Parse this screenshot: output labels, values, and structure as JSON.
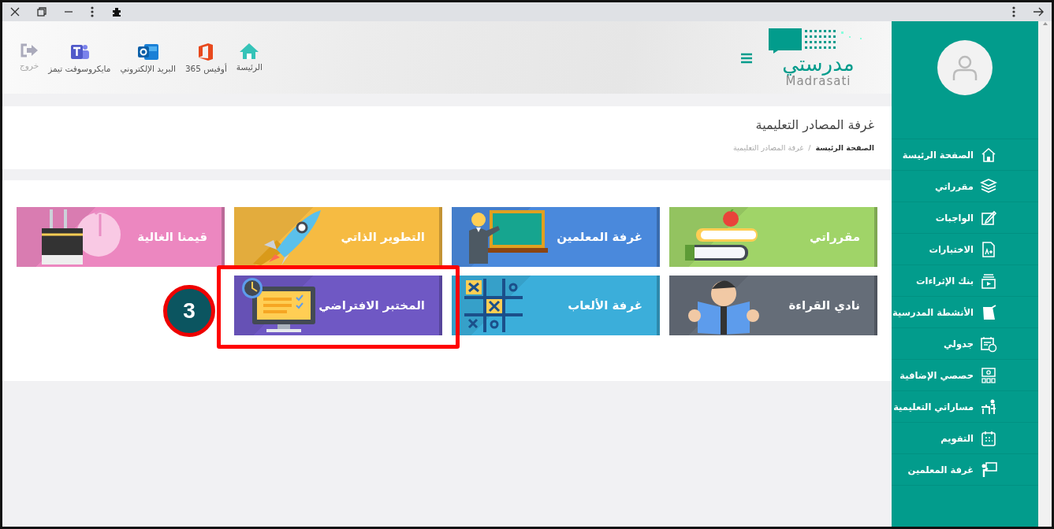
{
  "header_nav": [
    {
      "kind": "home",
      "label": "الرئيسة",
      "disabled": false
    },
    {
      "kind": "office",
      "label": "أوفيس 365",
      "disabled": false
    },
    {
      "kind": "outlook",
      "label": "البريد الإلكتروني",
      "disabled": false
    },
    {
      "kind": "teams",
      "label": "مايكروسوفت تيمز",
      "disabled": false
    },
    {
      "kind": "logout",
      "label": "خروج",
      "disabled": true
    }
  ],
  "logo": {
    "arabic": "مدرستي",
    "latin": "Madrasati"
  },
  "page_title": "غرفة المصادر التعليمية",
  "breadcrumb": {
    "home": "الصفحة الرئيسة",
    "separator": "/",
    "current": "غرفة المصادر التعليمية"
  },
  "tiles": [
    {
      "kind": "books",
      "label": "مقرراتي",
      "color": "#a0d468",
      "highlighted": false
    },
    {
      "kind": "teacher",
      "label": "غرفة المعلمين",
      "color": "#4a89dc",
      "highlighted": false
    },
    {
      "kind": "rocket",
      "label": "التطوير الذاتي",
      "color": "#f6bb42",
      "highlighted": false
    },
    {
      "kind": "kaaba",
      "label": "قيمنا الغالية",
      "color": "#ec87c0",
      "highlighted": false
    },
    {
      "kind": "reader",
      "label": "نادي القراءة",
      "color": "#656d78",
      "highlighted": false
    },
    {
      "kind": "tictactoe",
      "label": "غرفة الألعاب",
      "color": "#3baeda",
      "highlighted": false
    },
    {
      "kind": "computer",
      "label": "المختبر الافتراضي",
      "color": "#6f58c4",
      "highlighted": true
    }
  ],
  "annotation": {
    "label": "3"
  },
  "sidebar": {
    "items": [
      {
        "kind": "home",
        "label": "الصفحة الرئيسة"
      },
      {
        "kind": "stack",
        "label": "مقرراتي"
      },
      {
        "kind": "edit",
        "label": "الواجبات"
      },
      {
        "kind": "grade",
        "label": "الاختبارات"
      },
      {
        "kind": "video",
        "label": "بنك الإثراءات"
      },
      {
        "kind": "notebook",
        "label": "الأنشطة المدرسية"
      },
      {
        "kind": "schedule",
        "label": "جدولي"
      },
      {
        "kind": "classes",
        "label": "حصصي الإضافية"
      },
      {
        "kind": "teacher",
        "label": "مساراتي التعليمية"
      },
      {
        "kind": "calendar",
        "label": "التقويم"
      },
      {
        "kind": "board",
        "label": "غرفة المعلمين"
      }
    ]
  }
}
